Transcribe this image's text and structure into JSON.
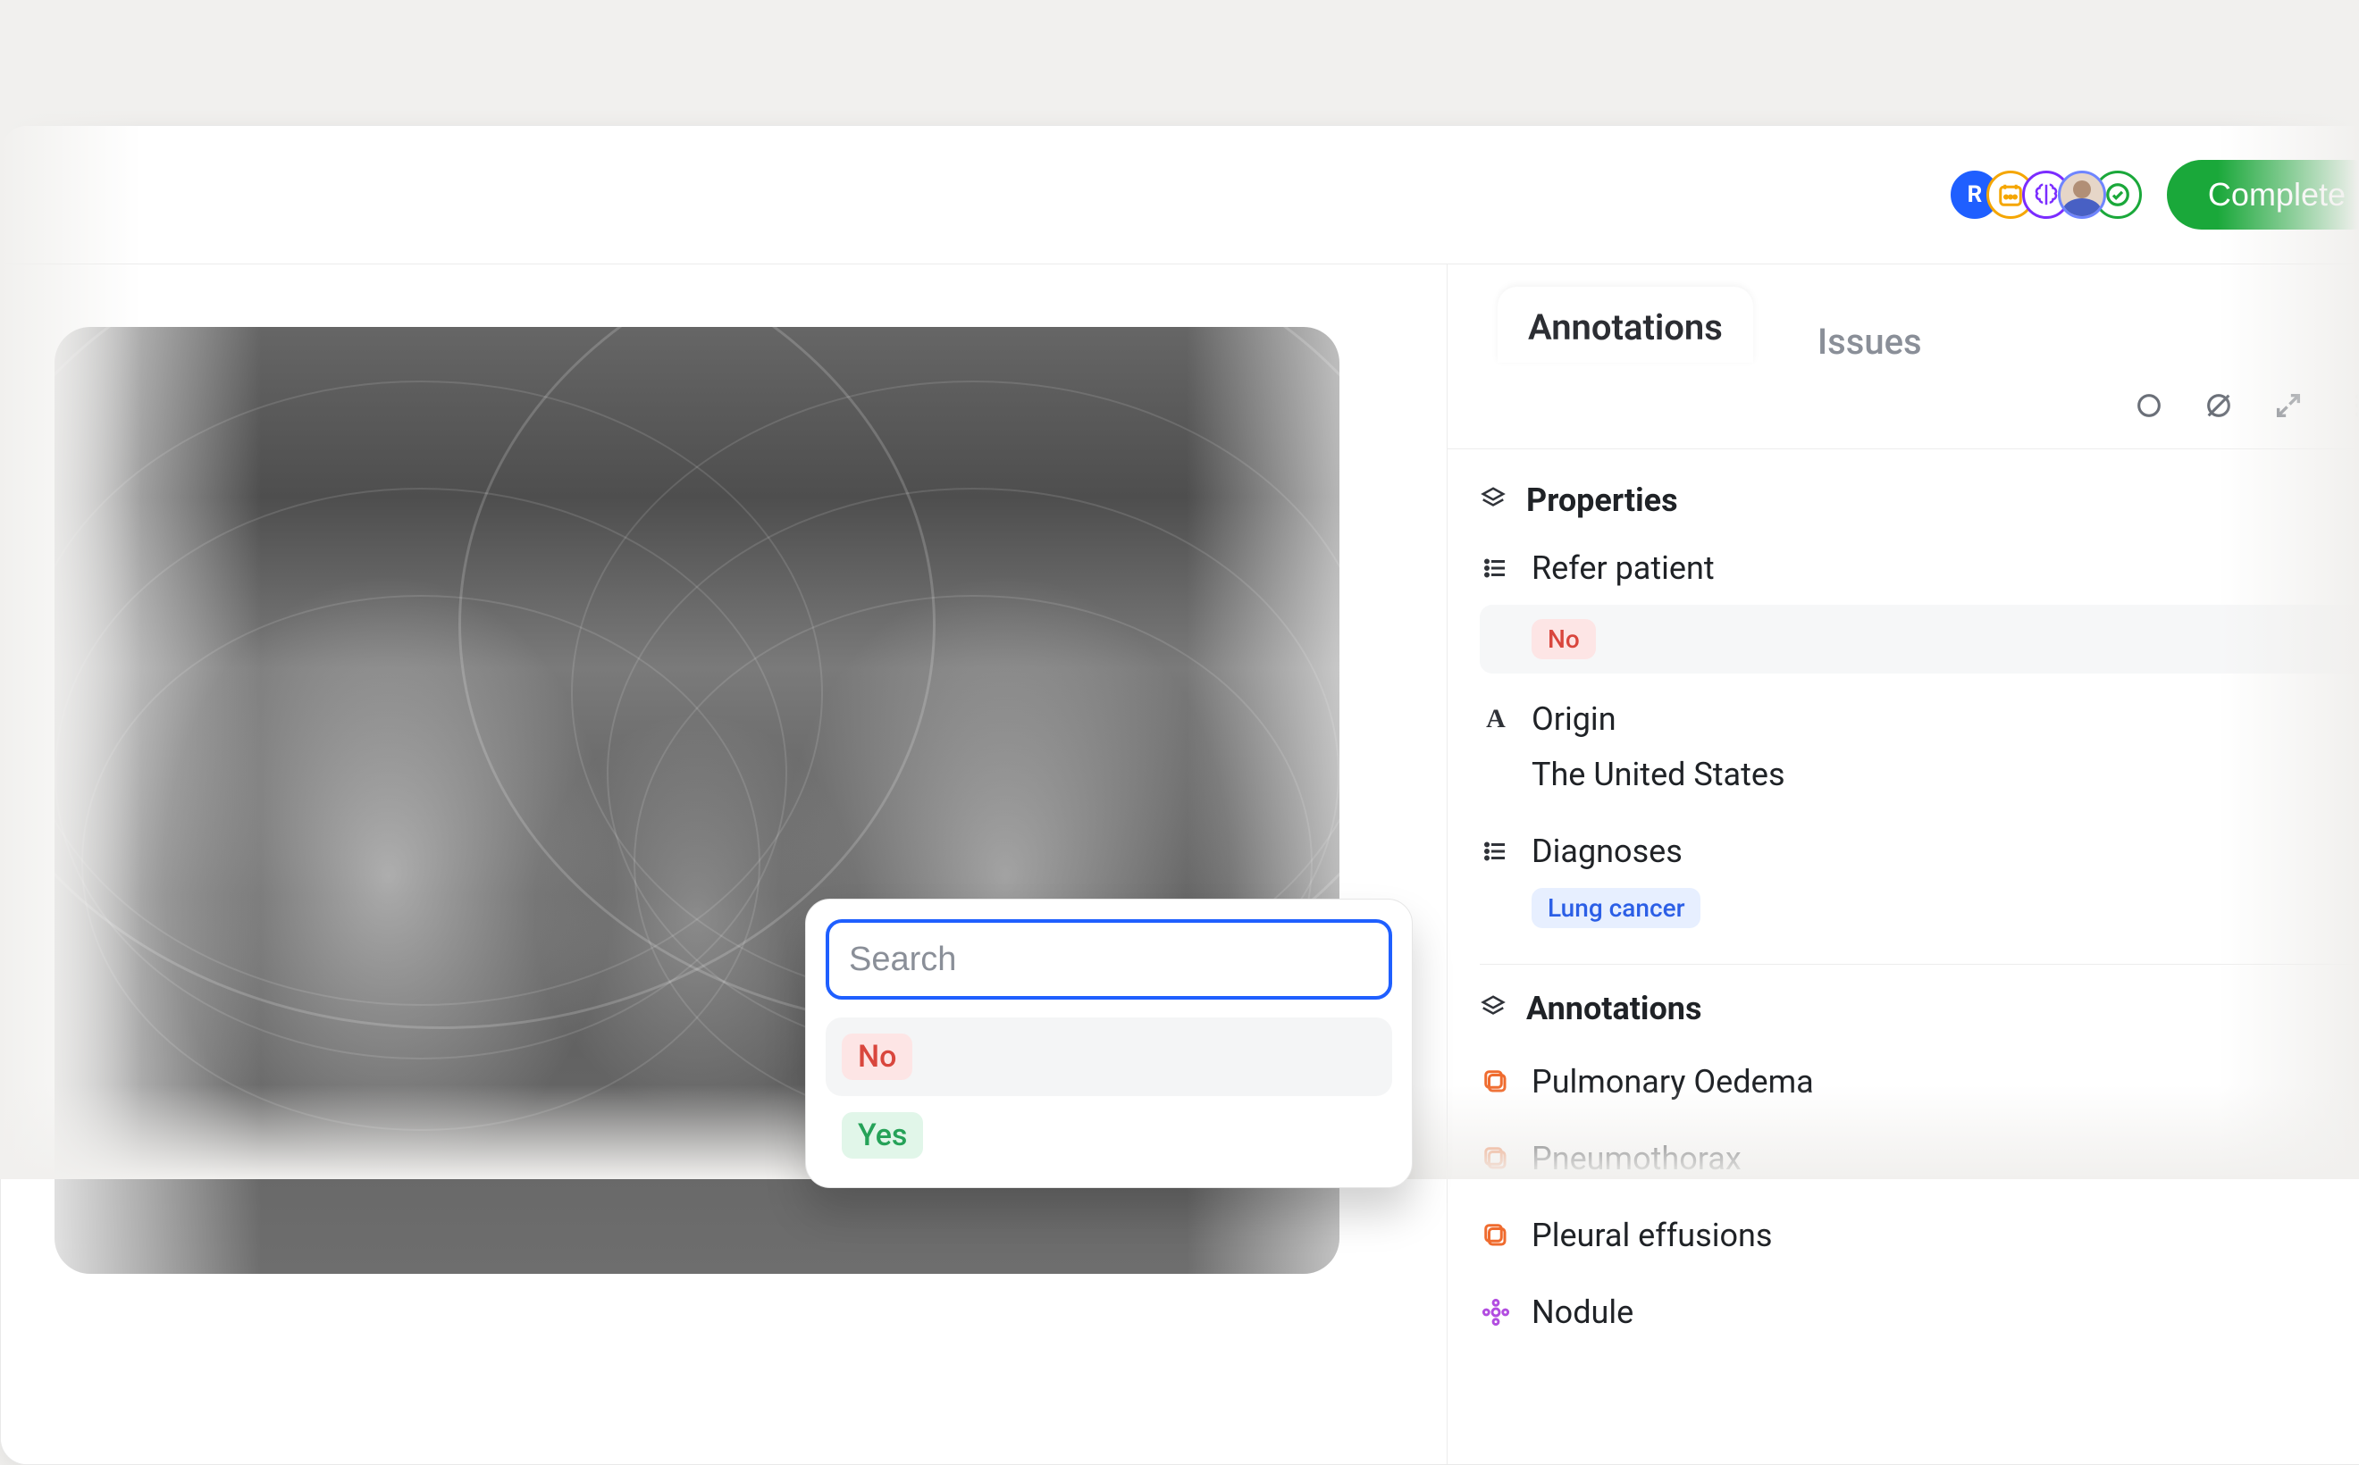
{
  "header": {
    "complete_label": "Complete",
    "icons": [
      "status-blue",
      "calendar",
      "brain",
      "person",
      "check"
    ]
  },
  "tabs": {
    "annotations": "Annotations",
    "issues": "Issues"
  },
  "popover": {
    "search_placeholder": "Search",
    "options": {
      "no": "No",
      "yes": "Yes"
    }
  },
  "properties": {
    "section_title": "Properties",
    "refer_patient": {
      "label": "Refer patient",
      "value": "No"
    },
    "origin": {
      "label": "Origin",
      "value": "The United States"
    },
    "diagnoses": {
      "label": "Diagnoses",
      "value": "Lung cancer"
    }
  },
  "annotations": {
    "section_title": "Annotations",
    "items": [
      {
        "label": "Pulmonary Oedema",
        "icon": "box"
      },
      {
        "label": "Pneumothorax",
        "icon": "box"
      },
      {
        "label": "Pleural effusions",
        "icon": "box"
      },
      {
        "label": "Nodule",
        "icon": "flower"
      }
    ]
  }
}
